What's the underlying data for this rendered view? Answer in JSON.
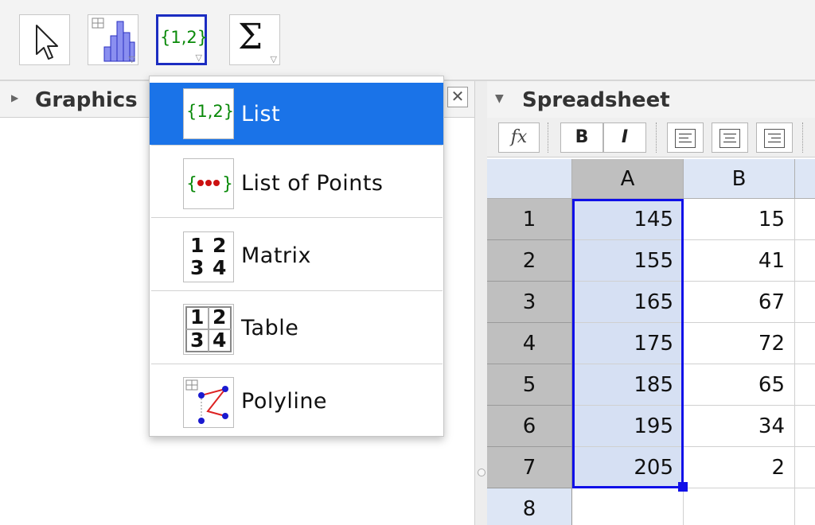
{
  "toolbar": {
    "tools": [
      {
        "name": "move-tool"
      },
      {
        "name": "one-variable-analysis-tool"
      },
      {
        "name": "list-tool",
        "icon_label": "{1,2}"
      },
      {
        "name": "sum-tool",
        "icon_label": "Σ"
      }
    ]
  },
  "graphics": {
    "title": "Graphics"
  },
  "spreadsheet": {
    "title": "Spreadsheet",
    "fx_label": "fx",
    "bold_label": "B",
    "italic_label": "I",
    "columns": [
      "A",
      "B"
    ],
    "rows": [
      {
        "n": "1",
        "a": "145",
        "b": "15"
      },
      {
        "n": "2",
        "a": "155",
        "b": "41"
      },
      {
        "n": "3",
        "a": "165",
        "b": "67"
      },
      {
        "n": "4",
        "a": "175",
        "b": "72"
      },
      {
        "n": "5",
        "a": "185",
        "b": "65"
      },
      {
        "n": "6",
        "a": "195",
        "b": "34"
      },
      {
        "n": "7",
        "a": "205",
        "b": "2"
      },
      {
        "n": "8",
        "a": "",
        "b": ""
      }
    ]
  },
  "dropdown": {
    "items": [
      {
        "label": "List",
        "icon_label": "{1,2}",
        "selected": true
      },
      {
        "label": "List of Points",
        "icon_label": "{•••}"
      },
      {
        "label": "Matrix",
        "icon_label": [
          "1",
          "2",
          "3",
          "4"
        ]
      },
      {
        "label": "Table",
        "icon_label": [
          "1",
          "2",
          "3",
          "4"
        ]
      },
      {
        "label": "Polyline"
      }
    ]
  },
  "colors": {
    "accent": "#1a73e8",
    "selection_border": "#1010e8",
    "selection_fill": "#d6e0f3",
    "list_icon_green": "#0a8a0a"
  }
}
